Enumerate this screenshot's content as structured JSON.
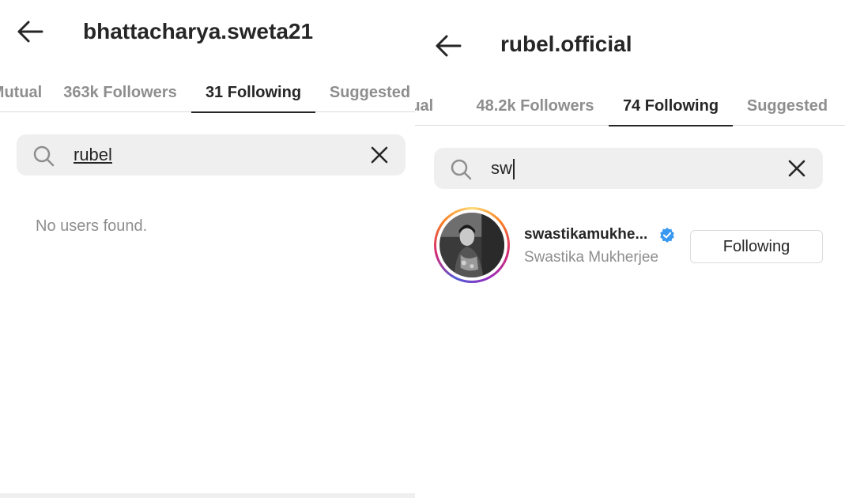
{
  "left": {
    "title": "bhattacharya.sweta21",
    "tabs": [
      {
        "label": "Mutual"
      },
      {
        "label": "363k Followers"
      },
      {
        "label": "31 Following"
      },
      {
        "label": "Suggested"
      }
    ],
    "search_value": "rubel",
    "empty_message": "No users found."
  },
  "right": {
    "title": "rubel.official",
    "tabs": [
      {
        "label": "Mutual"
      },
      {
        "label": "48.2k Followers"
      },
      {
        "label": "74 Following"
      },
      {
        "label": "Suggested"
      }
    ],
    "search_value": "sw",
    "result": {
      "username": "swastikamukhe...",
      "full_name": "Swastika Mukherjee",
      "button_label": "Following"
    }
  },
  "colors": {
    "text_primary": "#262626",
    "text_secondary": "#8e8e8e",
    "search_bg": "#efefef",
    "verified_blue": "#3897f0"
  },
  "icons": [
    "back-arrow-icon",
    "search-icon",
    "clear-icon",
    "verified-badge-icon"
  ]
}
